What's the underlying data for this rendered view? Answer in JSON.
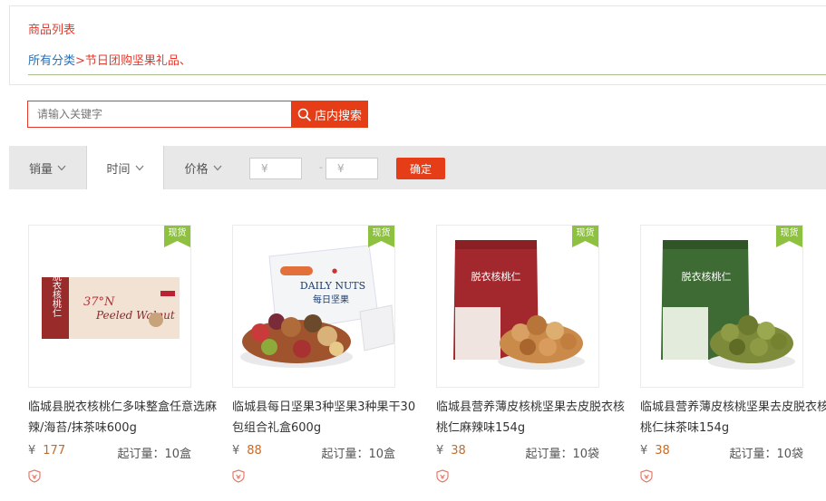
{
  "header": {
    "title": "商品列表",
    "breadcrumb_root": "所有分类",
    "breadcrumb_sep": ">",
    "breadcrumb_current": "节日团购坚果礼品、"
  },
  "search": {
    "placeholder": "请输入关键字",
    "button_label": "店内搜索"
  },
  "filters": {
    "sort_sales": "销量",
    "sort_time": "时间",
    "sort_price": "价格",
    "price_min_placeholder": "¥",
    "price_dash": "-",
    "price_max_placeholder": "¥",
    "confirm_label": "确定",
    "active_sort": "时间"
  },
  "badge_label": "现货",
  "colors": {
    "accent": "#e43d17",
    "breadcrumb_link": "#2a6fb7",
    "price": "#c56b2a",
    "badge_green": "#8dc13f"
  },
  "products": [
    {
      "name": "临城县脱衣核桃仁多味整盒任意选麻辣/海苔/抹茶味600g",
      "currency": "¥",
      "price": "177",
      "moq": "起订量：10盒",
      "image_text_1": "脱衣核桃仁",
      "image_text_2": "Peeled Walnut",
      "image_text_3": "37°N"
    },
    {
      "name": "临城县每日坚果3种坚果3种果干30包组合礼盒600g",
      "currency": "¥",
      "price": "88",
      "moq": "起订量：10盒",
      "image_text_1": "DAILY NUTS",
      "image_text_2": "每日坚果"
    },
    {
      "name": "临城县营养薄皮核桃坚果去皮脱衣核桃仁麻辣味154g",
      "currency": "¥",
      "price": "38",
      "moq": "起订量：10袋",
      "image_text_1": "脱衣核桃仁"
    },
    {
      "name": "临城县营养薄皮核桃坚果去皮脱衣核桃仁抹茶味154g",
      "currency": "¥",
      "price": "38",
      "moq": "起订量：10袋",
      "image_text_1": "脱衣核桃仁"
    }
  ]
}
